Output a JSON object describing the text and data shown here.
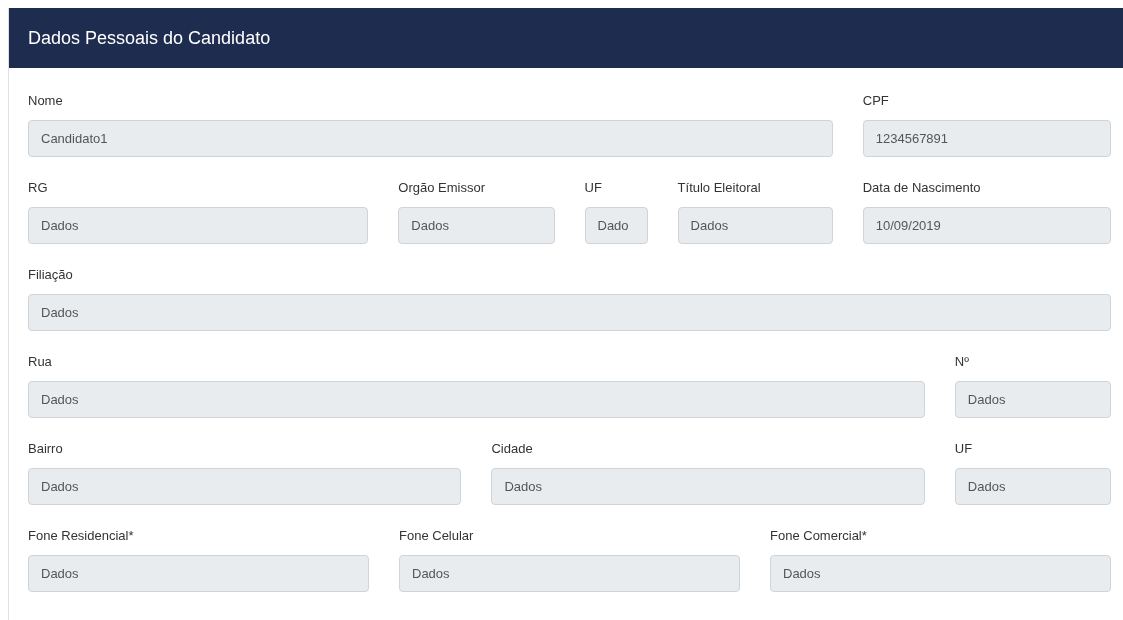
{
  "panel": {
    "title": "Dados Pessoais do Candidato"
  },
  "rows": [
    {
      "fields": [
        {
          "label": "Nome",
          "value": "Candidato1"
        },
        {
          "label": "CPF",
          "value": "1234567891"
        }
      ]
    },
    {
      "fields": [
        {
          "label": "RG",
          "value": "Dados"
        },
        {
          "label": "Orgão Emissor",
          "value": "Dados"
        },
        {
          "label": "UF",
          "value": "Dado"
        },
        {
          "label": "Título Eleitoral",
          "value": "Dados"
        },
        {
          "label": "Data de Nascimento",
          "value": "10/09/2019"
        }
      ]
    },
    {
      "fields": [
        {
          "label": "Filiação",
          "value": "Dados"
        }
      ]
    },
    {
      "fields": [
        {
          "label": "Rua",
          "value": "Dados"
        },
        {
          "label": "Nº",
          "value": "Dados"
        }
      ]
    },
    {
      "fields": [
        {
          "label": "Bairro",
          "value": "Dados"
        },
        {
          "label": "Cidade",
          "value": "Dados"
        },
        {
          "label": "UF",
          "value": "Dados"
        }
      ]
    },
    {
      "fields": [
        {
          "label": "Fone Residencial*",
          "value": "Dados"
        },
        {
          "label": "Fone Celular",
          "value": "Dados"
        },
        {
          "label": "Fone Comercial*",
          "value": "Dados"
        }
      ]
    }
  ]
}
